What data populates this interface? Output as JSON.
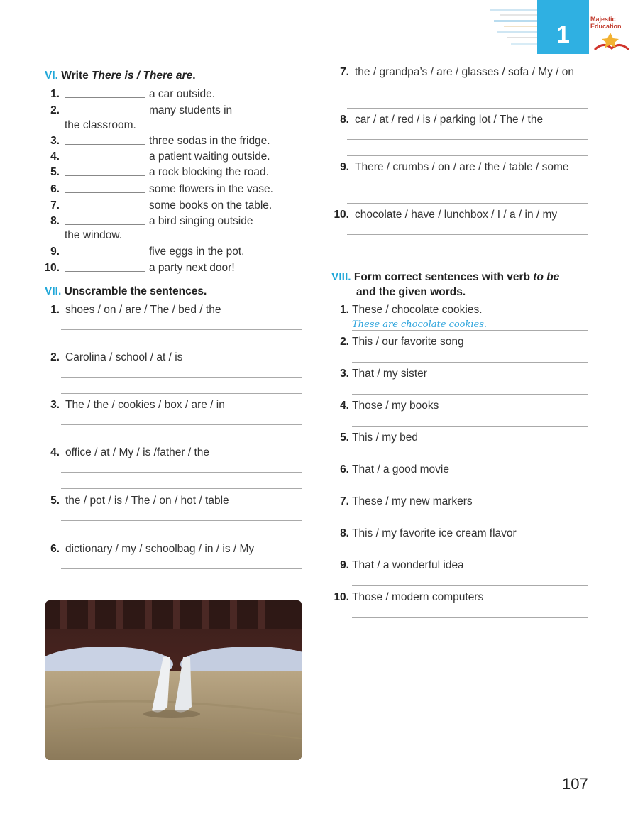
{
  "header": {
    "unit_number": "1",
    "logo_text_1": "Majestic",
    "logo_text_2": "Education"
  },
  "page_number": "107",
  "colors": {
    "accent": "#1fa7d8",
    "unit_tab": "#2fb0e2",
    "handwriting": "#2ba3dc"
  },
  "section6": {
    "roman": "VI.",
    "title_pre": "Write ",
    "title_em": "There is / There are",
    "title_post": ".",
    "items": [
      {
        "n": "1.",
        "text": "a car outside.",
        "cont": ""
      },
      {
        "n": "2.",
        "text": "many students in",
        "cont": "the classroom."
      },
      {
        "n": "3.",
        "text": "three sodas in the fridge.",
        "cont": ""
      },
      {
        "n": "4.",
        "text": "a patient waiting outside.",
        "cont": ""
      },
      {
        "n": "5.",
        "text": "a rock blocking the road.",
        "cont": ""
      },
      {
        "n": "6.",
        "text": "some flowers in the vase.",
        "cont": ""
      },
      {
        "n": "7.",
        "text": "some books on the table.",
        "cont": ""
      },
      {
        "n": "8.",
        "text": "a bird singing outside",
        "cont": "the window."
      },
      {
        "n": "9.",
        "text": "five eggs in the pot.",
        "cont": ""
      },
      {
        "n": "10.",
        "text": "a party next door!",
        "cont": ""
      }
    ]
  },
  "section7": {
    "roman": "VII.",
    "title": "Unscramble the sentences.",
    "items": [
      {
        "n": "1.",
        "text": "shoes / on / are / The / bed / the"
      },
      {
        "n": "2.",
        "text": "Carolina / school / at / is"
      },
      {
        "n": "3.",
        "text": "The / the / cookies / box / are / in"
      },
      {
        "n": "4.",
        "text": "office / at / My / is /father / the"
      },
      {
        "n": "5.",
        "text": "the / pot / is / The / on / hot / table"
      },
      {
        "n": "6.",
        "text": "dictionary / my / schoolbag / in / is / My"
      },
      {
        "n": "7.",
        "text": "the / grandpa’s / are / glasses / sofa / My / on"
      },
      {
        "n": "8.",
        "text": "car / at / red / is / parking lot / The / the"
      },
      {
        "n": "9.",
        "text": "There / crumbs / on / are / the / table / some"
      },
      {
        "n": "10.",
        "text": "chocolate / have / lunchbox / I / a / in / my"
      }
    ]
  },
  "section8": {
    "roman": "VIII.",
    "title_1": "Form correct sentences with verb ",
    "title_em": "to be",
    "title_2": "and the given words.",
    "example_answer": "These are chocolate cookies.",
    "items": [
      {
        "n": "1.",
        "text": "These / chocolate cookies."
      },
      {
        "n": "2.",
        "text": "This / our favorite song"
      },
      {
        "n": "3.",
        "text": "That / my sister"
      },
      {
        "n": "4.",
        "text": "Those / my books"
      },
      {
        "n": "5.",
        "text": "This / my bed"
      },
      {
        "n": "6.",
        "text": "That / a good movie"
      },
      {
        "n": "7.",
        "text": "These / my new markers"
      },
      {
        "n": "8.",
        "text": "This / my favorite ice cream flavor"
      },
      {
        "n": "9.",
        "text": "That / a wonderful idea"
      },
      {
        "n": "10.",
        "text": "Those / modern computers"
      }
    ]
  }
}
